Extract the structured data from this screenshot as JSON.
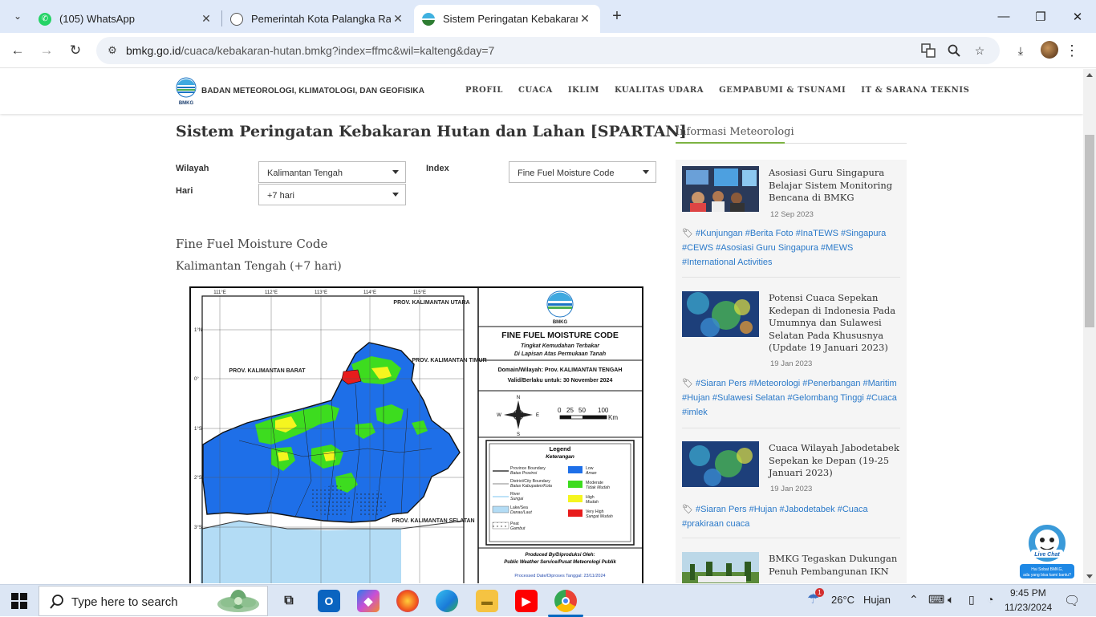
{
  "browser": {
    "tabs": [
      {
        "title": "(105) WhatsApp",
        "icon": "whatsapp-icon"
      },
      {
        "title": "Pemerintah Kota Palangka Raya",
        "icon": "globe-icon"
      },
      {
        "title": "Sistem Peringatan Kebakaran H",
        "icon": "bmkg-icon"
      }
    ],
    "url_host": "bmkg.go.id",
    "url_path": "/cuaca/kebakaran-hutan.bmkg?index=ffmc&wil=kalteng&day=7"
  },
  "site": {
    "org_name": "BADAN METEOROLOGI, KLIMATOLOGI, DAN GEOFISIKA",
    "logo_text": "BMKG",
    "nav": [
      "PROFIL",
      "CUACA",
      "IKLIM",
      "KUALITAS UDARA",
      "GEMPABUMI & TSUNAMI",
      "IT & SARANA TEKNIS"
    ]
  },
  "main": {
    "title": "Sistem Peringatan Kebakaran Hutan dan Lahan [SPARTAN]",
    "form": {
      "wilayah_label": "Wilayah",
      "wilayah_value": "Kalimantan Tengah",
      "hari_label": "Hari",
      "hari_value": "+7 hari",
      "index_label": "Index",
      "index_value": "Fine Fuel Moisture Code"
    },
    "section_title": "Fine Fuel Moisture Code",
    "section_subtitle": "Kalimantan Tengah (+7 hari)"
  },
  "map": {
    "lon_labels": [
      "111°E",
      "112°E",
      "113°E",
      "114°E",
      "115°E"
    ],
    "lat_labels": [
      "1°N",
      "0°",
      "1°S",
      "2°S",
      "3°S"
    ],
    "regions": [
      "PROV. KALIMANTAN UTARA",
      "PROV. KALIMANTAN BARAT",
      "PROV. KALIMANTAN TIMUR",
      "PROV. KALIMANTAN SELATAN"
    ],
    "panel_logo": "BMKG",
    "panel_title": "FINE FUEL MOISTURE CODE",
    "panel_sub1": "Tingkat Kemudahan Terbakar",
    "panel_sub2": "Di Lapisan Atas Permukaan Tanah",
    "domain": "Domain/Wilayah: Prov. KALIMANTAN TENGAH",
    "valid": "Valid/Berlaku untuk: 30 November 2024",
    "scale": [
      "0",
      "25",
      "50",
      "100"
    ],
    "scale_unit": "Km",
    "legend_title": "Legend",
    "legend_sub": "Keterangan",
    "legend_items": [
      {
        "en": "Province Boundary",
        "id": "Batas Provinsi"
      },
      {
        "en": "District/City Boundary",
        "id": "Batas Kabupaten/Kota"
      },
      {
        "en": "River",
        "id": "Sungai"
      },
      {
        "en": "Lake/Sea",
        "id": "Danau/Laut"
      },
      {
        "en": "Peat",
        "id": "Gambut"
      }
    ],
    "classes": [
      {
        "en": "Low",
        "id": "Aman",
        "color": "#1e6fe8"
      },
      {
        "en": "Moderate",
        "id": "Tidak Mudah",
        "color": "#3ddc1f"
      },
      {
        "en": "High",
        "id": "Mudah",
        "color": "#f5f51f"
      },
      {
        "en": "Very High",
        "id": "Sangat Mudah",
        "color": "#e81c1c"
      }
    ],
    "produced_by": "Produced By/Diproduksi Oleh:",
    "producer": "Public Weather Service/Pusat Meteorologi Publik",
    "processed": "Processed Date/Diproses Tanggal: 23/11/2024"
  },
  "sidebar": {
    "title": "Informasi Meteorologi",
    "news": [
      {
        "title": "Asosiasi Guru Singapura Belajar Sistem Monitoring Bencana di BMKG",
        "date": "12 Sep 2023",
        "tags": "#Kunjungan #Berita Foto #InaTEWS #Singapura #CEWS #Asosiasi Guru Singapura #MEWS #International Activities"
      },
      {
        "title": "Potensi Cuaca Sepekan Kedepan di Indonesia Pada Umumnya dan Sulawesi Selatan Pada Khususnya (Update 19 Januari 2023)",
        "date": "19 Jan 2023",
        "tags": "#Siaran Pers #Meteorologi #Penerbangan #Maritim #Hujan #Sulawesi Selatan #Gelombang Tinggi #Cuaca #imlek"
      },
      {
        "title": "Cuaca Wilayah Jabodetabek Sepekan ke Depan (19-25 Januari 2023)",
        "date": "19 Jan 2023",
        "tags": "#Siaran Pers #Hujan #Jabodetabek #Cuaca #prakiraan cuaca"
      },
      {
        "title": "BMKG Tegaskan Dukungan Penuh Pembangunan IKN",
        "date": "",
        "tags": ""
      }
    ]
  },
  "livechat": {
    "label": "Live Chat",
    "line1": "Hai Sobat BMKG,",
    "line2": "ada yang bisa kami bantu?"
  },
  "taskbar": {
    "search_placeholder": "Type here to search",
    "weather_temp": "26°C",
    "weather_desc": "Hujan",
    "time": "9:45 PM",
    "date": "11/23/2024",
    "weather_badge": "1"
  }
}
